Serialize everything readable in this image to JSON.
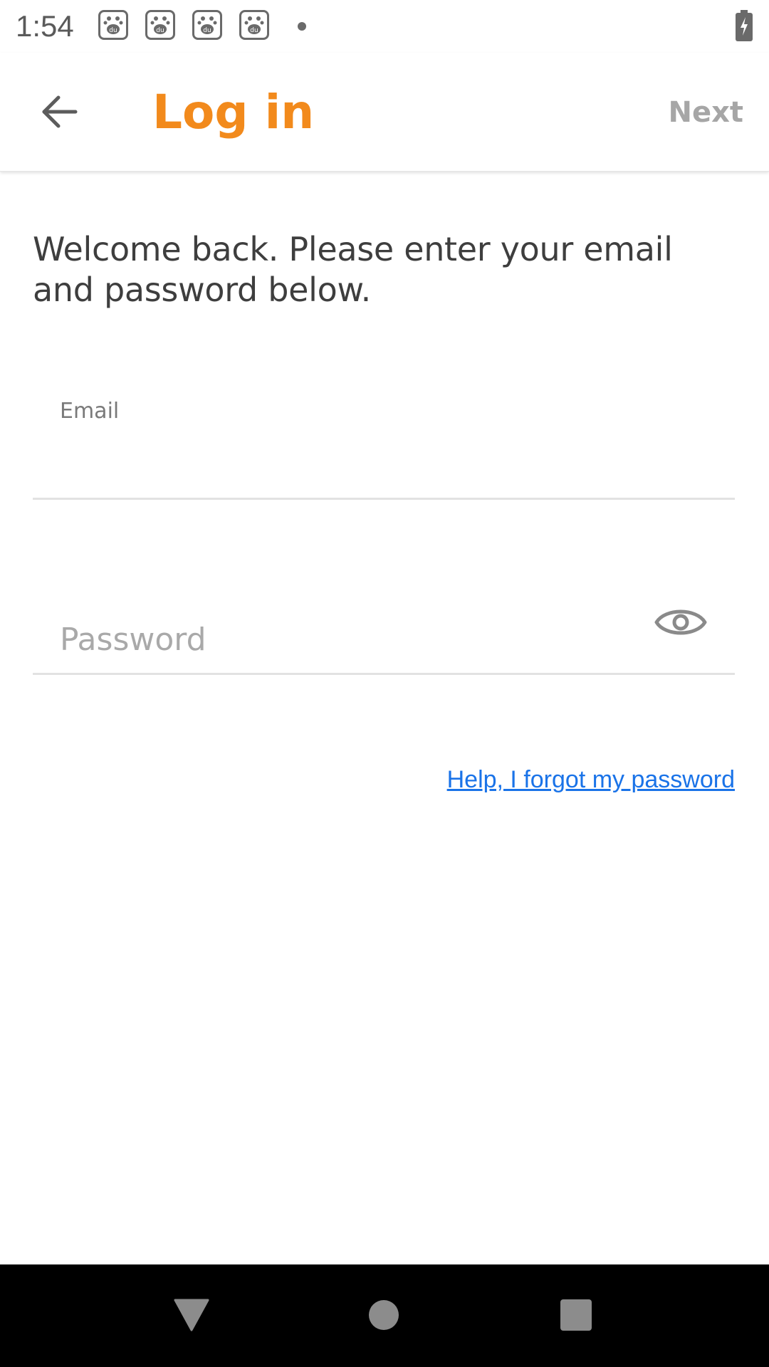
{
  "status_bar": {
    "time": "1:54",
    "notification_icons": [
      "baidu-app-icon",
      "baidu-app-icon",
      "baidu-app-icon",
      "baidu-app-icon"
    ],
    "battery_icon": "battery-charging-icon"
  },
  "app_bar": {
    "back_icon": "arrow-left-icon",
    "title": "Log in",
    "next_label": "Next"
  },
  "main": {
    "welcome_text": "Welcome back. Please enter your email and password below.",
    "email": {
      "label": "Email",
      "value": ""
    },
    "password": {
      "placeholder": "Password",
      "value": "",
      "toggle_icon": "eye-icon"
    },
    "forgot_link": "Help, I forgot my password"
  },
  "nav_bar": {
    "back_icon": "triangle-back-icon",
    "home_icon": "circle-home-icon",
    "recents_icon": "square-recents-icon"
  },
  "colors": {
    "accent": "#f28a1c",
    "link": "#1a73e8",
    "next_disabled": "#a6a6a6",
    "text": "#3e3e3e",
    "nav_bar_bg": "#000000"
  }
}
